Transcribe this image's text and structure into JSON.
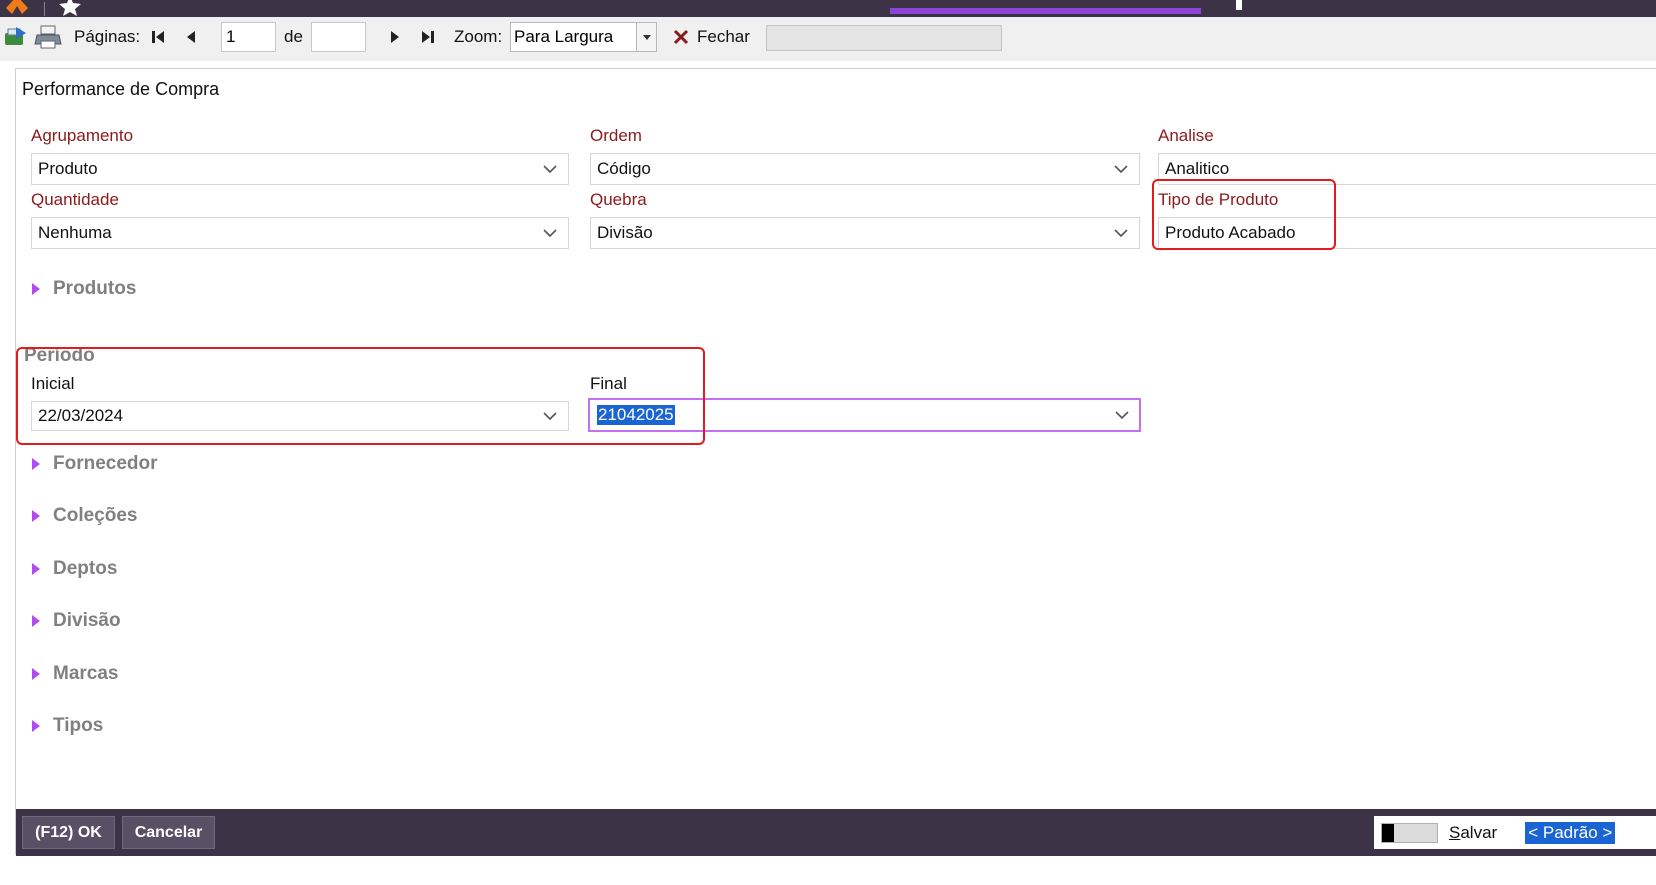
{
  "toolbar": {
    "pages_label": "Páginas:",
    "current_page": "1",
    "of_label": "de",
    "total_pages": "",
    "zoom_label": "Zoom:",
    "zoom_value": "Para Largura",
    "close_label": "Fechar"
  },
  "dialog": {
    "title": "Performance de Compra",
    "fields": {
      "agrupamento": {
        "label": "Agrupamento",
        "value": "Produto"
      },
      "ordem": {
        "label": "Ordem",
        "value": "Código"
      },
      "analise": {
        "label": "Analise",
        "value": "Analitico"
      },
      "quantidade": {
        "label": "Quantidade",
        "value": "Nenhuma"
      },
      "quebra": {
        "label": "Quebra",
        "value": "Divisão"
      },
      "tipo_produto": {
        "label": "Tipo de Produto",
        "value": "Produto Acabado"
      }
    },
    "periodo": {
      "title": "Período",
      "inicial_label": "Inicial",
      "inicial_value": "22/03/2024",
      "final_label": "Final",
      "final_value": "21042025"
    },
    "sections": {
      "produtos": "Produtos",
      "fornecedor": "Fornecedor",
      "colecoes": "Coleções",
      "deptos": "Deptos",
      "divisao": "Divisão",
      "marcas": "Marcas",
      "tipos": "Tipos"
    }
  },
  "footer": {
    "ok_label": "(F12) OK",
    "cancel_label": "Cancelar",
    "save_prefix": "S",
    "save_rest": "alvar",
    "preset_label": "< Padrão >"
  },
  "colors": {
    "dark_bar": "#3c3346",
    "accent_purple": "#8e44d8",
    "field_label_red": "#8b1a1a",
    "annotation_red": "#e41b1b",
    "selection_blue": "#1b64d4"
  },
  "icons": [
    "app-logo-icon",
    "star-icon",
    "export-icon",
    "print-icon",
    "first-page-icon",
    "prev-page-icon",
    "next-page-icon",
    "last-page-icon",
    "close-x-icon",
    "chevron-down-icon",
    "expand-triangle-icon"
  ]
}
